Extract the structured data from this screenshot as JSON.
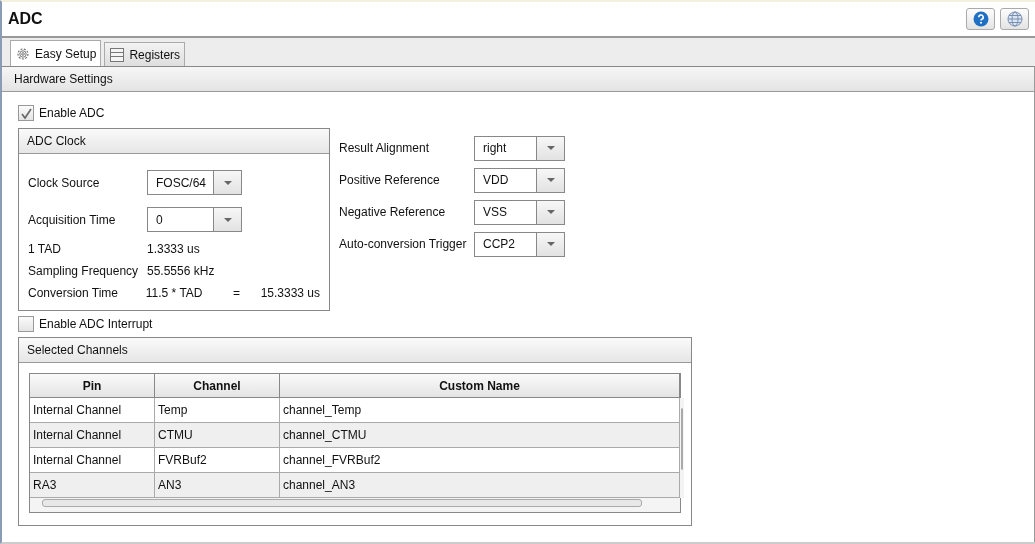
{
  "window": {
    "title": "ADC"
  },
  "tabs": [
    {
      "label": "Easy Setup",
      "selected": true
    },
    {
      "label": "Registers",
      "selected": false
    }
  ],
  "section": {
    "title": "Hardware Settings"
  },
  "enable_adc": {
    "label": "Enable ADC",
    "checked": true
  },
  "adc_clock": {
    "title": "ADC Clock",
    "dropdowns": [
      {
        "label": "Clock Source",
        "value": "FOSC/64"
      },
      {
        "label": "Acquisition Time",
        "value": "0"
      }
    ],
    "readouts": [
      {
        "label": "1 TAD",
        "value": "1.3333 us"
      },
      {
        "label": "Sampling Frequency",
        "value": "55.5556 kHz"
      },
      {
        "label": "Conversion Time",
        "value": "11.5 * TAD",
        "equals": "=",
        "result": "15.3333 us"
      }
    ]
  },
  "settings": [
    {
      "label": "Result Alignment",
      "value": "right"
    },
    {
      "label": "Positive Reference",
      "value": "VDD"
    },
    {
      "label": "Negative Reference",
      "value": "VSS"
    },
    {
      "label": "Auto-conversion Trigger",
      "value": "CCP2"
    }
  ],
  "enable_interrupt": {
    "label": "Enable ADC Interrupt",
    "checked": false
  },
  "channels": {
    "title": "Selected Channels",
    "columns": [
      "Pin",
      "Channel",
      "Custom Name"
    ],
    "rows": [
      [
        "Internal Channel",
        "Temp",
        "channel_Temp"
      ],
      [
        "Internal Channel",
        "CTMU",
        "channel_CTMU"
      ],
      [
        "Internal Channel",
        "FVRBuf2",
        "channel_FVRBuf2"
      ],
      [
        "RA3",
        "AN3",
        "channel_AN3"
      ]
    ]
  }
}
